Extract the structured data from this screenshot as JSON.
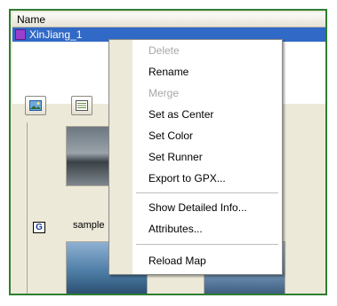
{
  "list": {
    "column_header": "Name",
    "rows": [
      {
        "label": "XinJiang_1",
        "color": "#9b3fcf",
        "selected": true
      }
    ]
  },
  "tabs": [
    {
      "icon": "photo-view-icon"
    },
    {
      "icon": "list-view-icon"
    }
  ],
  "gallery": {
    "badge": "G",
    "caption": "sample"
  },
  "context_menu": {
    "items": [
      {
        "label": "Delete",
        "enabled": false
      },
      {
        "label": "Rename",
        "enabled": true
      },
      {
        "label": "Merge",
        "enabled": false
      },
      {
        "label": "Set as Center",
        "enabled": true
      },
      {
        "label": "Set Color",
        "enabled": true
      },
      {
        "label": "Set Runner",
        "enabled": true
      },
      {
        "label": "Export to GPX...",
        "enabled": true
      },
      {
        "label": "Show Detailed Info...",
        "enabled": true
      },
      {
        "label": "Attributes...",
        "enabled": true
      },
      {
        "label": "Reload Map",
        "enabled": true
      }
    ]
  },
  "colors": {
    "selection": "#3169c6",
    "frame_border": "#2e7d32",
    "disabled_text": "#a7a6aa"
  }
}
